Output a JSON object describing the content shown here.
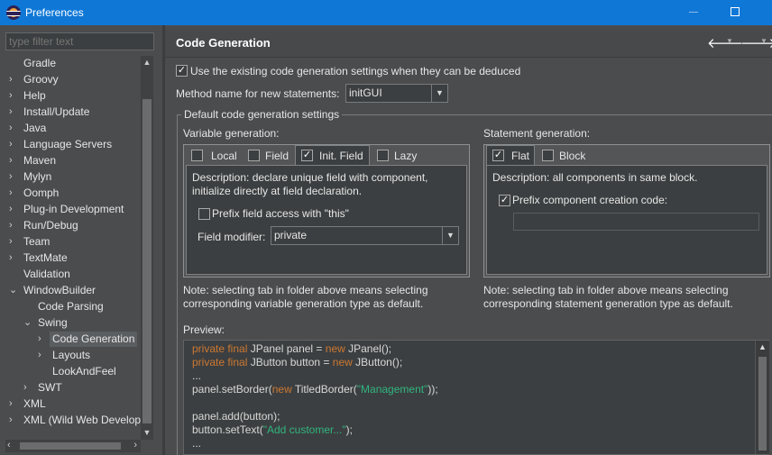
{
  "window": {
    "title": "Preferences"
  },
  "filter": {
    "placeholder": "type filter text"
  },
  "tree": [
    {
      "label": "Gradle",
      "chevron": ""
    },
    {
      "label": "Groovy",
      "chevron": "›"
    },
    {
      "label": "Help",
      "chevron": "›"
    },
    {
      "label": "Install/Update",
      "chevron": "›"
    },
    {
      "label": "Java",
      "chevron": "›"
    },
    {
      "label": "Language Servers",
      "chevron": "›"
    },
    {
      "label": "Maven",
      "chevron": "›"
    },
    {
      "label": "Mylyn",
      "chevron": "›"
    },
    {
      "label": "Oomph",
      "chevron": "›"
    },
    {
      "label": "Plug-in Development",
      "chevron": "›"
    },
    {
      "label": "Run/Debug",
      "chevron": "›"
    },
    {
      "label": "Team",
      "chevron": "›"
    },
    {
      "label": "TextMate",
      "chevron": "›"
    },
    {
      "label": "Validation",
      "chevron": ""
    },
    {
      "label": "WindowBuilder",
      "chevron": "⌄"
    },
    {
      "label": "Code Parsing",
      "chevron": ""
    },
    {
      "label": "Swing",
      "chevron": "⌄"
    },
    {
      "label": "Code Generation",
      "chevron": "›",
      "selected": true
    },
    {
      "label": "Layouts",
      "chevron": "›"
    },
    {
      "label": "LookAndFeel",
      "chevron": ""
    },
    {
      "label": "SWT",
      "chevron": "›"
    },
    {
      "label": "XML",
      "chevron": "›"
    },
    {
      "label": "XML (Wild Web Develop",
      "chevron": "›"
    }
  ],
  "page": {
    "title": "Code Generation"
  },
  "settings": {
    "use_existing": {
      "label": "Use the existing code generation settings when they can be deduced",
      "checked": true
    },
    "method_label": "Method name for new statements:",
    "method_value": "initGUI",
    "group_label": "Default code generation settings"
  },
  "variable": {
    "heading": "Variable generation:",
    "tabs": [
      {
        "label": "Local",
        "checked": false
      },
      {
        "label": "Field",
        "checked": false
      },
      {
        "label": "Init. Field",
        "checked": true,
        "active": true
      },
      {
        "label": "Lazy",
        "checked": false
      }
    ],
    "description_1": "Description: declare unique field with component,",
    "description_2": "initialize directly at field declaration.",
    "prefix_label": "Prefix field access with \"this\"",
    "prefix_checked": false,
    "modifier_label": "Field modifier:",
    "modifier_value": "private",
    "note_1": "Note: selecting tab in folder above means selecting",
    "note_2": "corresponding variable generation type as default."
  },
  "statement": {
    "heading": "Statement generation:",
    "tabs": [
      {
        "label": "Flat",
        "checked": true,
        "active": true
      },
      {
        "label": "Block",
        "checked": false
      }
    ],
    "description": "Description: all components in same block.",
    "prefix_label": "Prefix component creation code:",
    "prefix_checked": true,
    "note_1": "Note: selecting tab in folder above means selecting",
    "note_2": "corresponding statement generation type as default."
  },
  "preview": {
    "label": "Preview:",
    "lines": [
      [
        {
          "t": "private final ",
          "k": "kw"
        },
        {
          "t": "JPanel panel = ",
          "k": ""
        },
        {
          "t": "new ",
          "k": "kw"
        },
        {
          "t": "JPanel();",
          "k": ""
        }
      ],
      [
        {
          "t": "private final ",
          "k": "kw"
        },
        {
          "t": "JButton button = ",
          "k": ""
        },
        {
          "t": "new ",
          "k": "kw"
        },
        {
          "t": "JButton();",
          "k": ""
        }
      ],
      [
        {
          "t": "...",
          "k": ""
        }
      ],
      [
        {
          "t": "panel.setBorder(",
          "k": ""
        },
        {
          "t": "new ",
          "k": "kw"
        },
        {
          "t": "TitledBorder(",
          "k": ""
        },
        {
          "t": "\"Management\"",
          "k": "str"
        },
        {
          "t": "));",
          "k": ""
        }
      ],
      [],
      [
        {
          "t": "panel.add(button);",
          "k": ""
        }
      ],
      [
        {
          "t": "button.setText(",
          "k": ""
        },
        {
          "t": "\"Add customer...\"",
          "k": "str"
        },
        {
          "t": ");",
          "k": ""
        }
      ],
      [
        {
          "t": "...",
          "k": ""
        }
      ]
    ]
  }
}
